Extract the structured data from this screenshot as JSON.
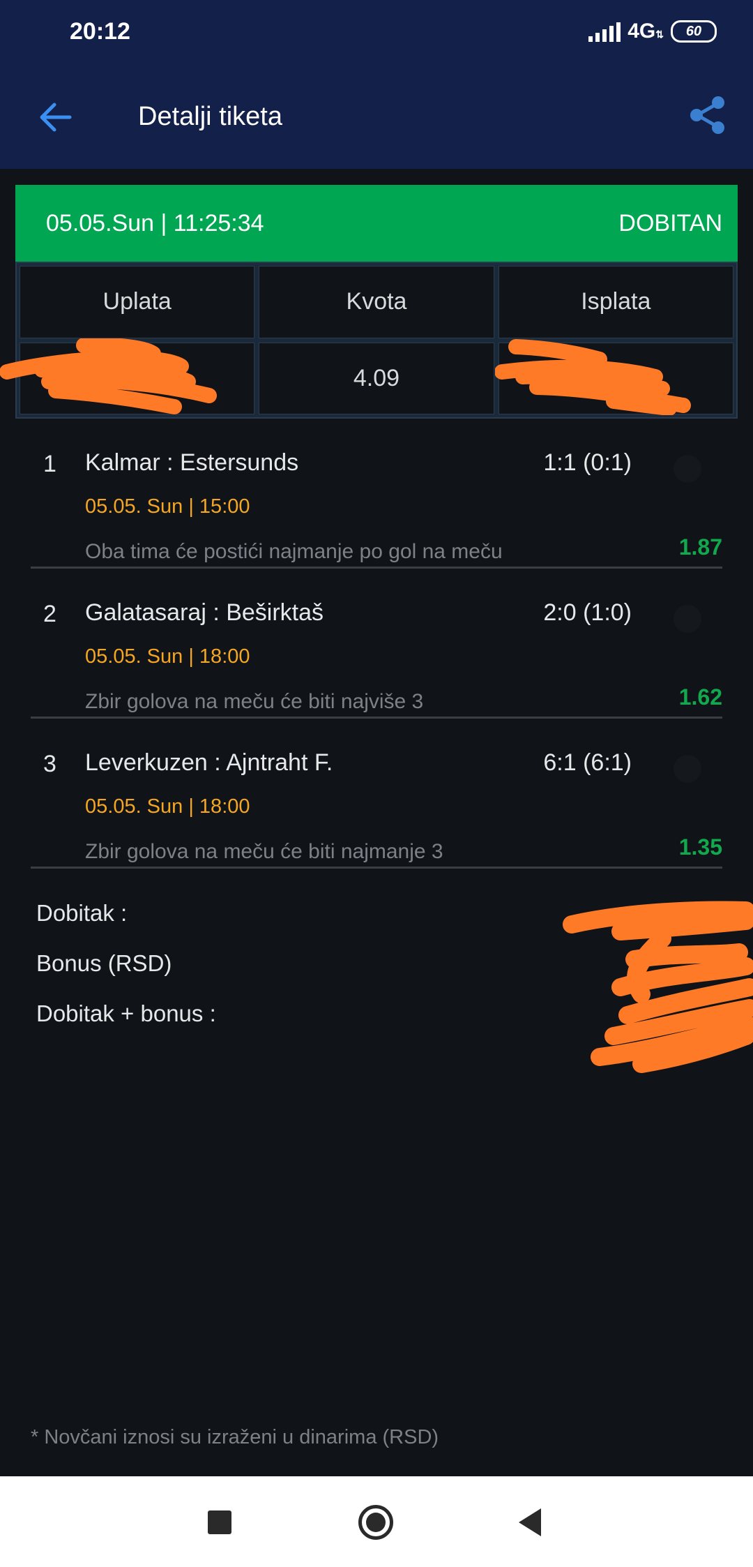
{
  "status_bar": {
    "time": "20:12",
    "network": "4G",
    "battery": "60"
  },
  "app_bar": {
    "title": "Detalji tiketa",
    "back_icon": "arrow-left-icon",
    "share_icon": "share-icon"
  },
  "ticket": {
    "datetime": "05.05.Sun | 11:25:34",
    "status": "DOBITAN",
    "status_color": "#00a651",
    "headers": [
      "Uplata",
      "Kvota",
      "Isplata"
    ],
    "values": [
      "",
      "4.09",
      ""
    ]
  },
  "matches": [
    {
      "number": "1",
      "teams": "Kalmar : Estersunds",
      "score": "1:1 (0:1)",
      "date": "05.05. Sun | 15:00",
      "pick": "Oba tima će postići najmanje po gol na meču",
      "odd": "1.87"
    },
    {
      "number": "2",
      "teams": "Galatasaraj : Beširktaš",
      "score": "2:0 (1:0)",
      "date": "05.05. Sun | 18:00",
      "pick": "Zbir golova na meču će biti najviše 3",
      "odd": "1.62"
    },
    {
      "number": "3",
      "teams": "Leverkuzen : Ajntraht F.",
      "score": "6:1 (6:1)",
      "date": "05.05. Sun | 18:00",
      "pick": "Zbir golova na meču će biti najmanje 3",
      "odd": "1.35"
    }
  ],
  "totals": {
    "win_label": "Dobitak :",
    "bonus_label": "Bonus (RSD)",
    "win_bonus_label": "Dobitak + bonus :"
  },
  "footnote": "* Novčani iznosi su izraženi u dinarima (RSD)",
  "colors": {
    "accent": "#00a651",
    "date": "#f5a623",
    "odd": "#12a84e",
    "header_bg": "#13204a"
  }
}
